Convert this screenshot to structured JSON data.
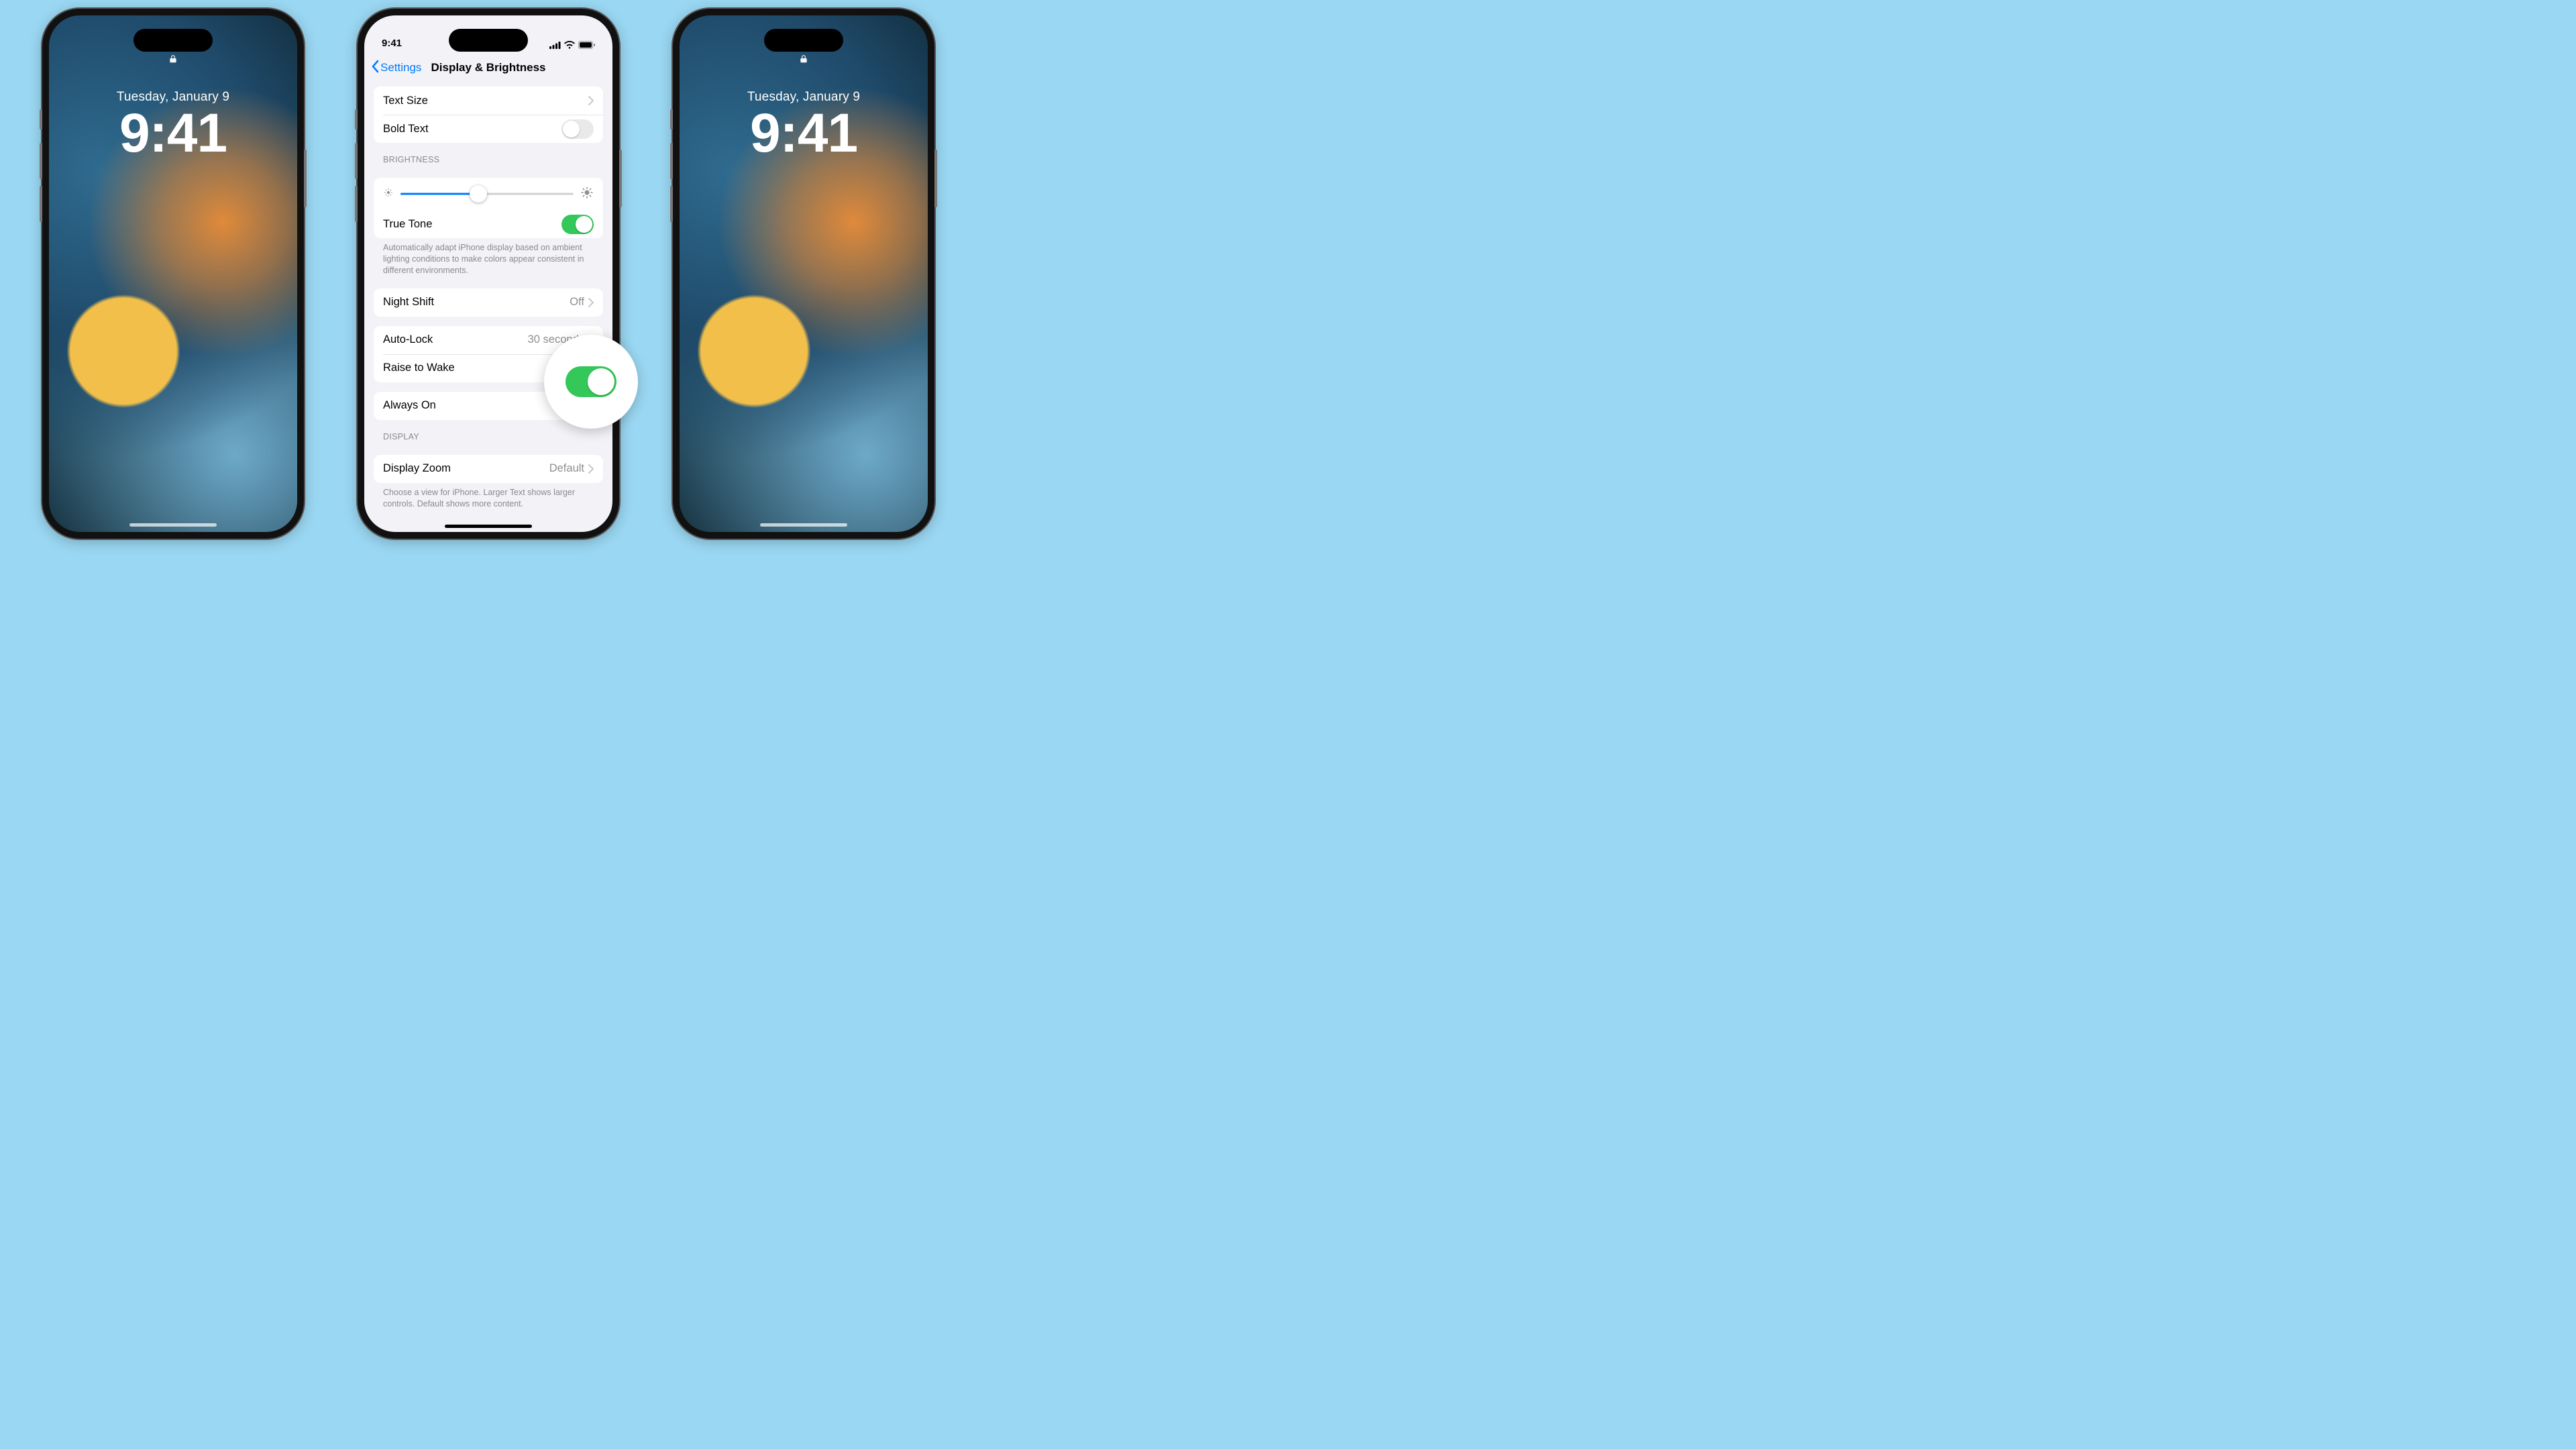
{
  "lockscreen": {
    "date": "Tuesday, January 9",
    "time": "9:41",
    "lock_icon": "lock-icon"
  },
  "status": {
    "time": "9:41"
  },
  "nav": {
    "back": "Settings",
    "title": "Display & Brightness"
  },
  "rows": {
    "textsize": "Text Size",
    "bold": "Bold Text",
    "truetone": "True Tone",
    "nightshift": "Night Shift",
    "nightshift_value": "Off",
    "autolock": "Auto-Lock",
    "autolock_value": "30 seconds",
    "raisewake": "Raise to Wake",
    "alwayson": "Always On",
    "displayzoom": "Display Zoom",
    "displayzoom_value": "Default"
  },
  "sections": {
    "brightness_header": "BRIGHTNESS",
    "truetone_footer": "Automatically adapt iPhone display based on ambient lighting conditions to make colors appear consistent in different environments.",
    "display_header": "DISPLAY",
    "displayzoom_footer": "Choose a view for iPhone. Larger Text shows larger controls. Default shows more content."
  },
  "toggles": {
    "bold": false,
    "truetone": true,
    "raisewake": true,
    "alwayson": true
  },
  "brightness_percent": 45
}
